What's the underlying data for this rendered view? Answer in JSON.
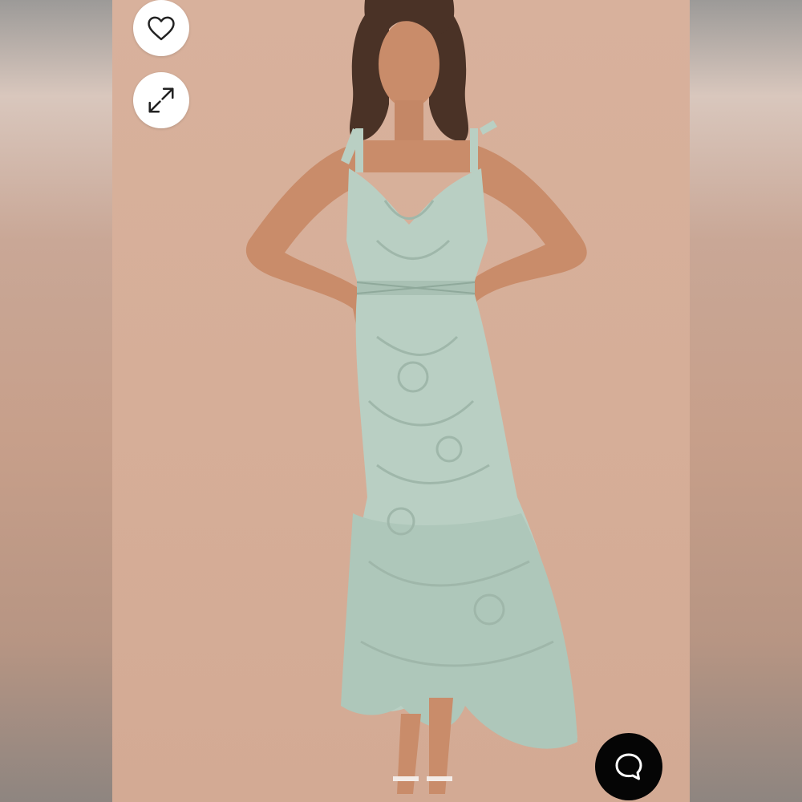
{
  "viewer": {
    "favorite_icon": "heart-icon",
    "expand_icon": "expand-arrows-icon",
    "chat_icon": "chat-bubble-icon",
    "photo_subject": "product-photo-sage-lace-midi-dress"
  },
  "colors": {
    "backdrop": "#d6ae98",
    "dress": "#b9cfc3",
    "dress_shadow": "#9fb7aa",
    "skin": "#c98c6a",
    "hair": "#4a3226",
    "button_bg": "#ffffff",
    "chat_bg": "#050505"
  }
}
